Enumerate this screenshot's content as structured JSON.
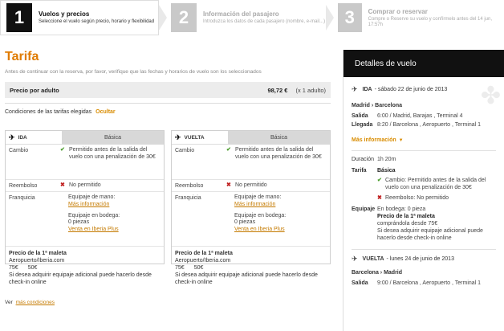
{
  "steps": [
    {
      "number": "1",
      "title": "Vuelos y precios",
      "subtitle": "Seleccione el vuelo según precio, horario y flexibilidad"
    },
    {
      "number": "2",
      "title": "Información del pasajero",
      "subtitle": "Introduzca los datos de cada pasajero (nombre, e-mail...)"
    },
    {
      "number": "3",
      "title": "Comprar o reservar",
      "subtitle": "Compre o Reserve su vuelo y confírmelo antes del 14 jun, 17:57h"
    }
  ],
  "main": {
    "title": "Tarifa",
    "intro": "Antes de continuar con la reserva, por favor, verifique que las fechas y horarios de vuelo son los seleccionados",
    "price_label": "Precio por adulto",
    "price_amount": "98,72 €",
    "price_pax": "(x 1 adulto)",
    "conditions_label": "Condiciones de las tarifas elegidas",
    "hide_label": "Ocultar",
    "more_prefix": "Ver",
    "more_link": "más condiciones"
  },
  "fares": [
    {
      "direction": "IDA",
      "fare_name": "Básica",
      "labels": {
        "cambio": "Cambio",
        "reembolso": "Reembolso",
        "franquicia": "Franquicia"
      },
      "cambio": "Permitido antes de la salida del vuelo con una penalización de 30€",
      "reembolso": "No permitido",
      "hand_luggage": "Equipaje de mano:",
      "hand_link": "Más información",
      "hold_luggage": "Equipaje en bodega:",
      "hold_value": "0 piezas",
      "hold_link": "Venta en Iberia Plus",
      "bottom_title": "Precio de la 1ª maleta",
      "bottom_line": "Aeropuerto/Iberia.com",
      "price1": "75€",
      "price2": "50€",
      "bottom_note": "Si desea adquirir equipaje adicional puede hacerlo desde check-in online"
    },
    {
      "direction": "VUELTA",
      "fare_name": "Básica",
      "labels": {
        "cambio": "Cambio",
        "reembolso": "Reembolso",
        "franquicia": "Franquicia"
      },
      "cambio": "Permitido antes de la salida del vuelo con una penalización de 30€",
      "reembolso": "No permitido",
      "hand_luggage": "Equipaje de mano:",
      "hand_link": "Más información",
      "hold_luggage": "Equipaje en bodega:",
      "hold_value": "0 piezas",
      "hold_link": "Venta en Iberia Plus",
      "bottom_title": "Precio de la 1ª maleta",
      "bottom_line": "Aeropuerto/Iberia.com",
      "price1": "75€",
      "price2": "50€",
      "bottom_note": "Si desea adquirir equipaje adicional puede hacerlo desde check-in online"
    }
  ],
  "panel": {
    "title": "Detalles de vuelo",
    "ida": {
      "label": "IDA",
      "date": "- sábado 22 de junio de 2013",
      "route": "Madrid › Barcelona",
      "salida_label": "Salida",
      "salida": "6:00 / Madrid, Barajas , Terminal 4",
      "llegada_label": "Llegada",
      "llegada": "8:20 / Barcelona , Aeropuerto , Terminal 1",
      "more_info": "Más información",
      "duration_label": "Duración",
      "duration": "1h 20m",
      "tarifa_label": "Tarifa",
      "tarifa_name": "Básica",
      "tarifa_cambio": "Cambio: Permitido antes de la salida del vuelo con una penalización de 30€",
      "tarifa_reembolso": "Reembolso: No permitido",
      "equipaje_label": "Equipaje",
      "equipaje_bodega": "En bodega: 0 pieza",
      "equipaje_precio_title": "Precio de la 1ª maleta",
      "equipaje_precio_line": "comprándola desde 75€",
      "equipaje_note": "Si desea adquirir equipaje adicional puede hacerlo desde check-in online"
    },
    "vuelta": {
      "label": "VUELTA",
      "date": "- lunes 24 de junio de 2013",
      "route": "Barcelona › Madrid",
      "salida_label": "Salida",
      "salida": "9:00 / Barcelona , Aeropuerto , Terminal 1"
    }
  }
}
